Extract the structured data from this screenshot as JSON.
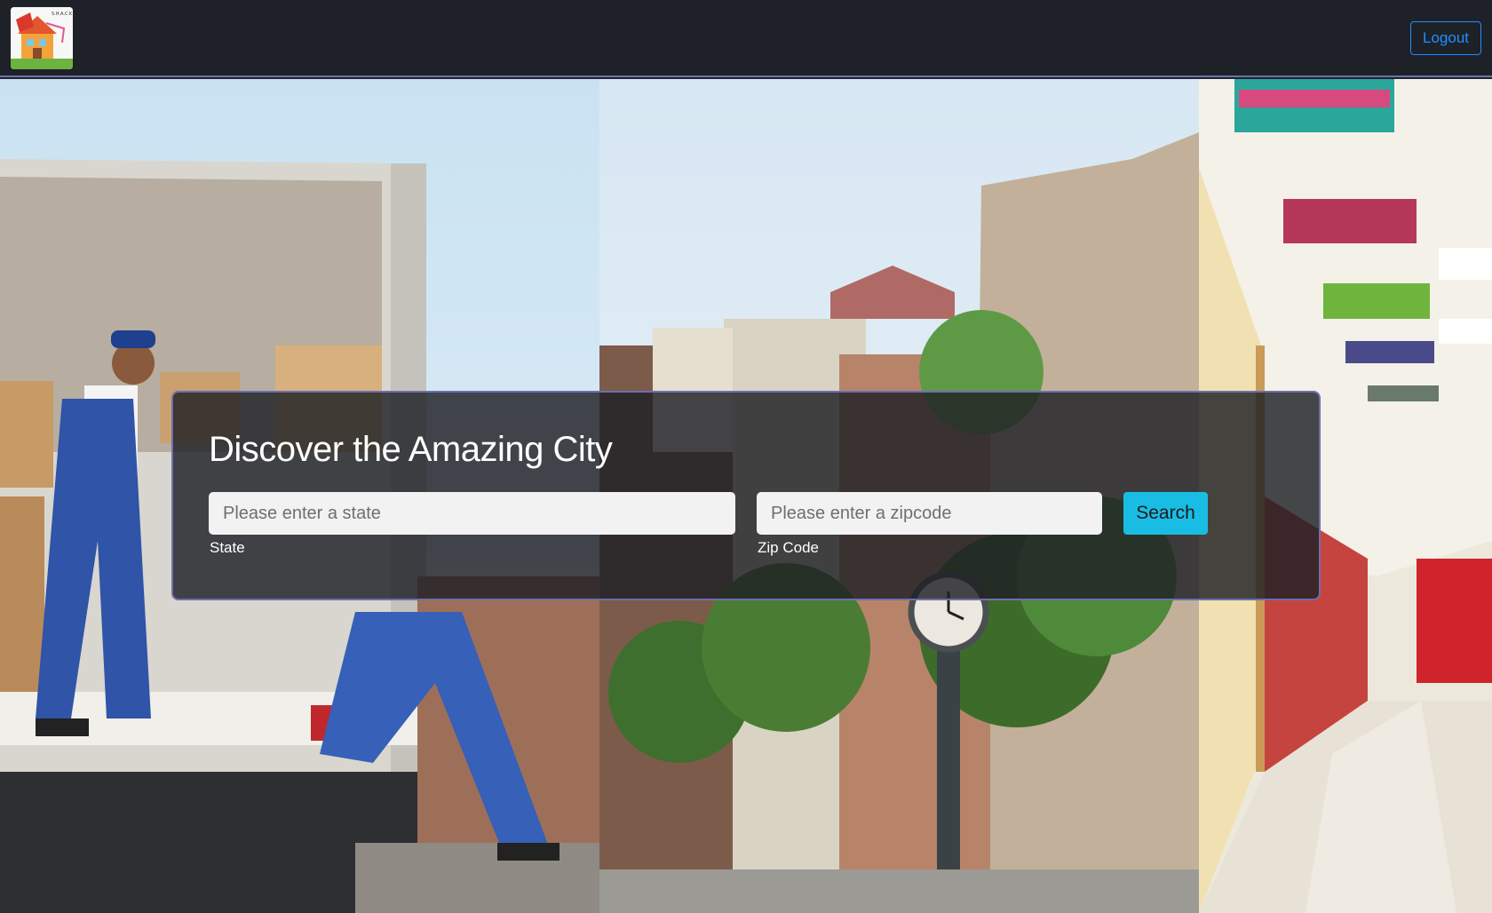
{
  "navbar": {
    "brand_logo_text": "S.H.A.C.K",
    "logout_label": "Logout"
  },
  "search_card": {
    "title": "Discover the Amazing City",
    "state_field": {
      "placeholder": "Please enter a state",
      "value": "",
      "label": "State"
    },
    "zip_field": {
      "placeholder": "Please enter a zipcode",
      "value": "",
      "label": "Zip Code"
    },
    "search_label": "Search"
  },
  "hero": {
    "panels": [
      "movers-photo",
      "street-photo",
      "hallway-photo"
    ]
  },
  "colors": {
    "navbar_bg": "#1e2128",
    "accent_border": "#6f6fae",
    "logout_blue": "#1e8fff",
    "search_button": "#19bde3"
  }
}
